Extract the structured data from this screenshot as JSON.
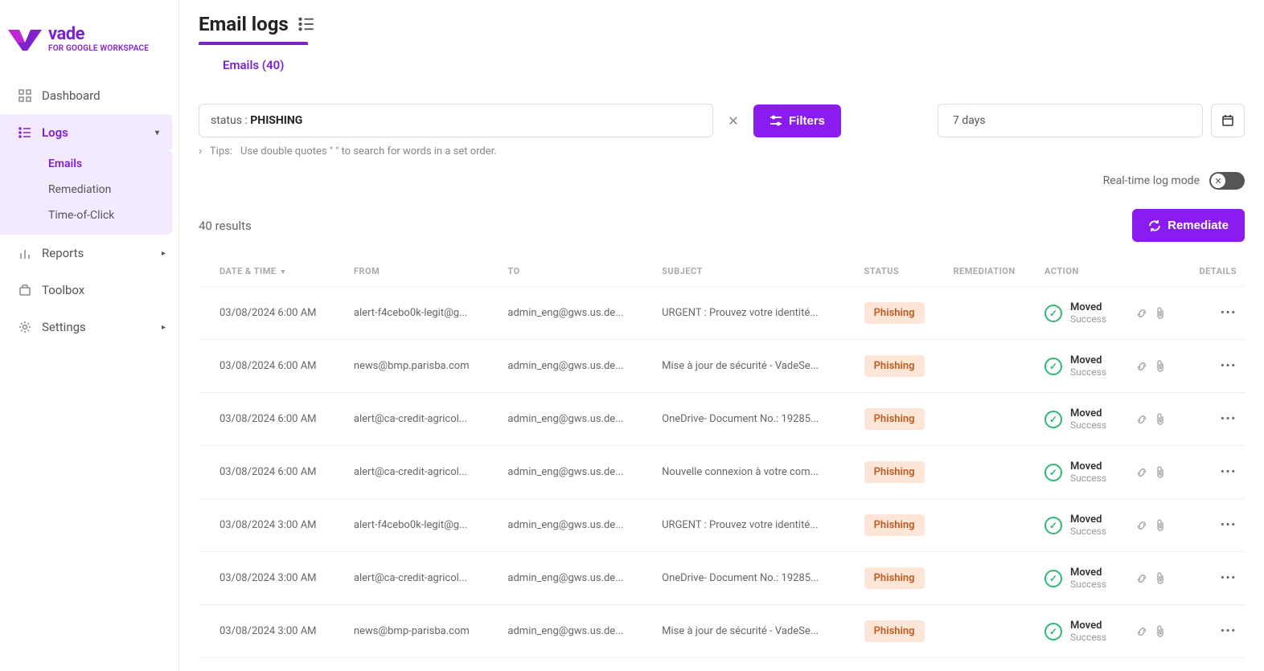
{
  "brand": {
    "name": "vade",
    "subtitle": "FOR GOOGLE WORKSPACE"
  },
  "sidebar": {
    "items": [
      {
        "label": "Dashboard"
      },
      {
        "label": "Logs"
      },
      {
        "label": "Reports"
      },
      {
        "label": "Toolbox"
      },
      {
        "label": "Settings"
      }
    ],
    "subitems": [
      {
        "label": "Emails"
      },
      {
        "label": "Remediation"
      },
      {
        "label": "Time-of-Click"
      }
    ]
  },
  "page": {
    "title": "Email logs",
    "tab_label": "Emails (40)",
    "search_prefix": "status : ",
    "search_value": "PHISHING",
    "filters_btn": "Filters",
    "date_range": "7 days",
    "tips_label": "Tips:",
    "tips_text": "Use double quotes \" \" to search for words in a set order.",
    "realtime_label": "Real-time log mode",
    "results_text": "40 results",
    "remediate_btn": "Remediate"
  },
  "table": {
    "headers": {
      "date": "DATE & TIME",
      "from": "FROM",
      "to": "TO",
      "subject": "SUBJECT",
      "status": "STATUS",
      "remediation": "REMEDIATION",
      "action": "ACTION",
      "details": "DETAILS"
    },
    "rows": [
      {
        "date": "03/08/2024 6:00 AM",
        "from": "alert-f4cebo0k-legit@g...",
        "to": "admin_eng@gws.us.de...",
        "subject": "URGENT : Prouvez votre identité...",
        "status": "Phishing",
        "action_title": "Moved",
        "action_sub": "Success"
      },
      {
        "date": "03/08/2024 6:00 AM",
        "from": "news@bmp.parisba.com",
        "to": "admin_eng@gws.us.de...",
        "subject": "Mise à jour de sécurité - VadeSe...",
        "status": "Phishing",
        "action_title": "Moved",
        "action_sub": "Success"
      },
      {
        "date": "03/08/2024 6:00 AM",
        "from": "alert@ca-credit-agricol...",
        "to": "admin_eng@gws.us.de...",
        "subject": "OneDrive- Document No.: 19285...",
        "status": "Phishing",
        "action_title": "Moved",
        "action_sub": "Success"
      },
      {
        "date": "03/08/2024 6:00 AM",
        "from": "alert@ca-credit-agricol...",
        "to": "admin_eng@gws.us.de...",
        "subject": "Nouvelle connexion à votre com...",
        "status": "Phishing",
        "action_title": "Moved",
        "action_sub": "Success"
      },
      {
        "date": "03/08/2024 3:00 AM",
        "from": "alert-f4cebo0k-legit@g...",
        "to": "admin_eng@gws.us.de...",
        "subject": "URGENT : Prouvez votre identité...",
        "status": "Phishing",
        "action_title": "Moved",
        "action_sub": "Success"
      },
      {
        "date": "03/08/2024 3:00 AM",
        "from": "alert@ca-credit-agricol...",
        "to": "admin_eng@gws.us.de...",
        "subject": "OneDrive- Document No.: 19285...",
        "status": "Phishing",
        "action_title": "Moved",
        "action_sub": "Success"
      },
      {
        "date": "03/08/2024 3:00 AM",
        "from": "news@bmp-parisba.com",
        "to": "admin_eng@gws.us.de...",
        "subject": "Mise à jour de sécurité - VadeSe...",
        "status": "Phishing",
        "action_title": "Moved",
        "action_sub": "Success"
      }
    ]
  }
}
